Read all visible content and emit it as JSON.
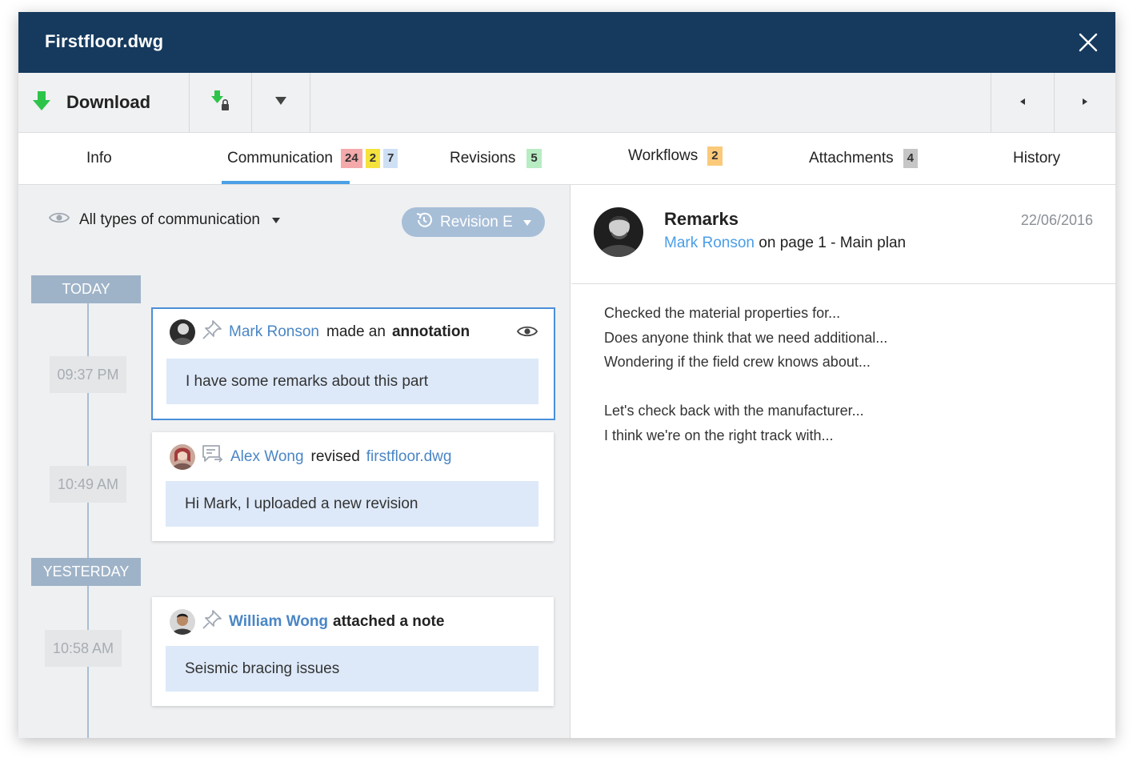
{
  "window": {
    "title": "Firstfloor.dwg"
  },
  "toolbar": {
    "download_label": "Download"
  },
  "tabs": [
    {
      "label": "Info"
    },
    {
      "label": "Communication",
      "badges": [
        "24",
        "2",
        "7"
      ]
    },
    {
      "label": "Revisions",
      "badges": [
        "5"
      ]
    },
    {
      "label": "Workflows",
      "badges": [
        "2"
      ]
    },
    {
      "label": "Attachments",
      "badges": [
        "4"
      ]
    },
    {
      "label": "History"
    }
  ],
  "filter": {
    "label": "All types of communication",
    "revision_label": "Revision E"
  },
  "timeline": {
    "days": [
      "TODAY",
      "YESTERDAY"
    ],
    "times": [
      "09:37 PM",
      "10:49 AM",
      "10:58 AM"
    ]
  },
  "cards": [
    {
      "user": "Mark Ronson",
      "verb": "made an",
      "object": "annotation",
      "body": "I have some remarks about this part"
    },
    {
      "user": "Alex Wong",
      "verb": "revised",
      "link": "firstfloor.dwg",
      "body": "Hi Mark, I uploaded a new revision"
    },
    {
      "user": "William Wong",
      "verb": "attached a note",
      "body": "Seismic bracing issues"
    }
  ],
  "detail": {
    "title": "Remarks",
    "user": "Mark Ronson",
    "location": "on page 1 - Main plan",
    "date": "22/06/2016",
    "lines": [
      "Checked the material properties for...",
      "Does anyone think that we need additional...",
      "Wondering if the field crew knows about...",
      "",
      "Let's check back with the manufacturer...",
      "I think we're on the right track with..."
    ]
  },
  "colors": {
    "titlebar": "#163a5e",
    "accent": "#4aa0e6",
    "link": "#4a86c5",
    "download_green": "#2ec44a"
  }
}
